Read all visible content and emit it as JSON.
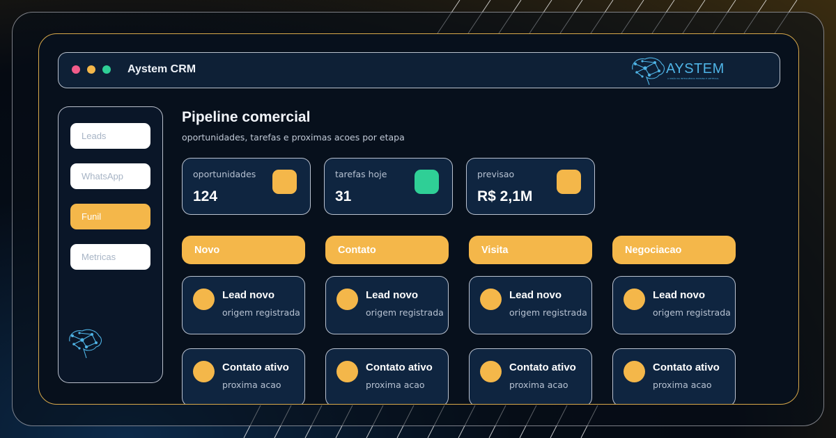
{
  "window": {
    "title": "Aystem CRM",
    "brand_name": "AYSTEM",
    "brand_tagline": "A UNIÃO DA INTELIGÊNCIA HUMANA E ARTIFICIAL",
    "brand_color": "#4fb4e6"
  },
  "sidebar": {
    "items": [
      {
        "label": "Leads",
        "active": false
      },
      {
        "label": "WhatsApp",
        "active": false
      },
      {
        "label": "Funil",
        "active": true
      },
      {
        "label": "Metricas",
        "active": false
      }
    ]
  },
  "main": {
    "title": "Pipeline comercial",
    "subtitle": "oportunidades, tarefas e proximas acoes por etapa"
  },
  "stats": [
    {
      "label": "oportunidades",
      "value": "124",
      "badge_color": "#f4b74a"
    },
    {
      "label": "tarefas hoje",
      "value": "31",
      "badge_color": "#2fcf96"
    },
    {
      "label": "previsao",
      "value": "R$ 2,1M",
      "badge_color": "#f4b74a"
    }
  ],
  "columns": [
    {
      "header": "Novo",
      "cards": [
        {
          "title": "Lead novo",
          "subtitle": "origem registrada"
        },
        {
          "title": "Contato ativo",
          "subtitle": "proxima acao"
        }
      ]
    },
    {
      "header": "Contato",
      "cards": [
        {
          "title": "Lead novo",
          "subtitle": "origem registrada"
        },
        {
          "title": "Contato ativo",
          "subtitle": "proxima acao"
        }
      ]
    },
    {
      "header": "Visita",
      "cards": [
        {
          "title": "Lead novo",
          "subtitle": "origem registrada"
        },
        {
          "title": "Contato ativo",
          "subtitle": "proxima acao"
        }
      ]
    },
    {
      "header": "Negociacao",
      "cards": [
        {
          "title": "Lead novo",
          "subtitle": "origem registrada"
        },
        {
          "title": "Contato ativo",
          "subtitle": "proxima acao"
        }
      ]
    }
  ],
  "colors": {
    "accent": "#f4b74a",
    "success": "#2fcf96",
    "danger": "#f25c8a"
  }
}
